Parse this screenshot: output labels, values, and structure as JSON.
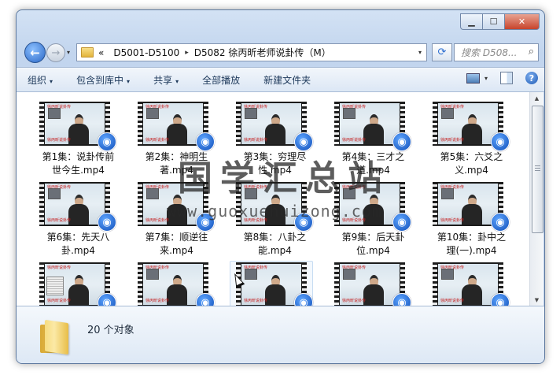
{
  "window": {
    "caption": {
      "minimize": "▁",
      "maximize": "☐",
      "close": "✕"
    }
  },
  "address": {
    "prefix": "«",
    "crumbs": [
      "D5001-D5100",
      "D5082 徐丙昕老师说卦传（M）"
    ],
    "separator": "▸",
    "dropdown": "▾",
    "refresh": "⟳",
    "search_placeholder": "搜索 D508...",
    "search_icon": "magnifier-icon"
  },
  "nav": {
    "back": "←",
    "forward": "→",
    "history": "▾"
  },
  "toolbar": {
    "items": [
      {
        "label": "组织",
        "dd": "▾"
      },
      {
        "label": "包含到库中",
        "dd": "▾"
      },
      {
        "label": "共享",
        "dd": "▾"
      },
      {
        "label": "全部播放",
        "dd": ""
      },
      {
        "label": "新建文件夹",
        "dd": ""
      }
    ],
    "view_dd": "▾",
    "help": "?"
  },
  "files": [
    {
      "line1": "第1集：说卦传前",
      "line2": "世今生.mp4"
    },
    {
      "line1": "第2集：神明生",
      "line2": "著.mp4"
    },
    {
      "line1": "第3集：穷理尽",
      "line2": "性.mp4"
    },
    {
      "line1": "第4集：三才之",
      "line2": "道.mp4"
    },
    {
      "line1": "第5集：六爻之",
      "line2": "义.mp4"
    },
    {
      "line1": "第6集：先天八",
      "line2": "卦.mp4"
    },
    {
      "line1": "第7集：顺逆往",
      "line2": "来.mp4"
    },
    {
      "line1": "第8集：八卦之",
      "line2": "能.mp4"
    },
    {
      "line1": "第9集：后天卦",
      "line2": "位.mp4"
    },
    {
      "line1": "第10集：卦中之",
      "line2": "理(一).mp4"
    },
    {
      "line1": "",
      "line2": ""
    },
    {
      "line1": "",
      "line2": ""
    },
    {
      "line1": "",
      "line2": ""
    },
    {
      "line1": "",
      "line2": ""
    },
    {
      "line1": "",
      "line2": ""
    }
  ],
  "thumb_text": {
    "top": "徐丙昕说卦传",
    "bottom": "徐丙昕说卦传"
  },
  "scroll": {
    "up": "▲",
    "down": "▼"
  },
  "details": {
    "count": "20 个对象"
  },
  "watermark": {
    "title": "国学汇总站",
    "url": "www.guoxuehuizong.com"
  },
  "colors": {
    "accent": "#1e395b",
    "badge": "#0f4db8",
    "window_border": "#5f7aa0"
  }
}
